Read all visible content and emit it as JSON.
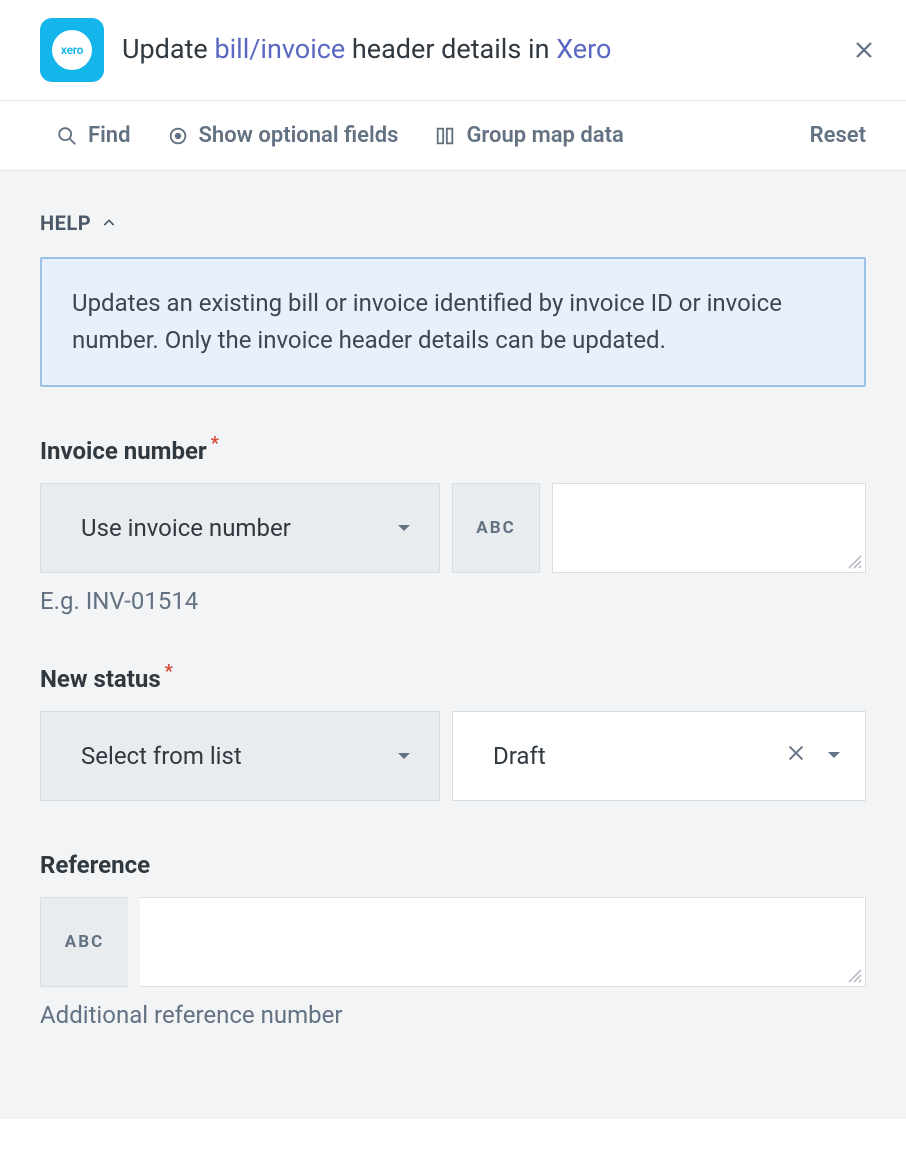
{
  "header": {
    "logo_text": "xero",
    "title_prefix": "Update ",
    "title_link1": "bill/invoice",
    "title_mid": " header details in ",
    "title_link2": "Xero"
  },
  "toolbar": {
    "find": "Find",
    "show_optional": "Show optional fields",
    "group_map": "Group map data",
    "reset": "Reset"
  },
  "help": {
    "label": "HELP",
    "text": "Updates an existing bill or invoice identified by invoice ID or invoice number. Only the invoice header details can be updated."
  },
  "fields": {
    "invoice_number": {
      "label": "Invoice number",
      "required_mark": "*",
      "mode": "Use invoice number",
      "type_badge": "ABC",
      "value": "",
      "helper": "E.g. INV-01514"
    },
    "new_status": {
      "label": "New status",
      "required_mark": "*",
      "mode": "Select from list",
      "value": "Draft"
    },
    "reference": {
      "label": "Reference",
      "type_badge": "ABC",
      "value": "",
      "helper": "Additional reference number"
    }
  }
}
